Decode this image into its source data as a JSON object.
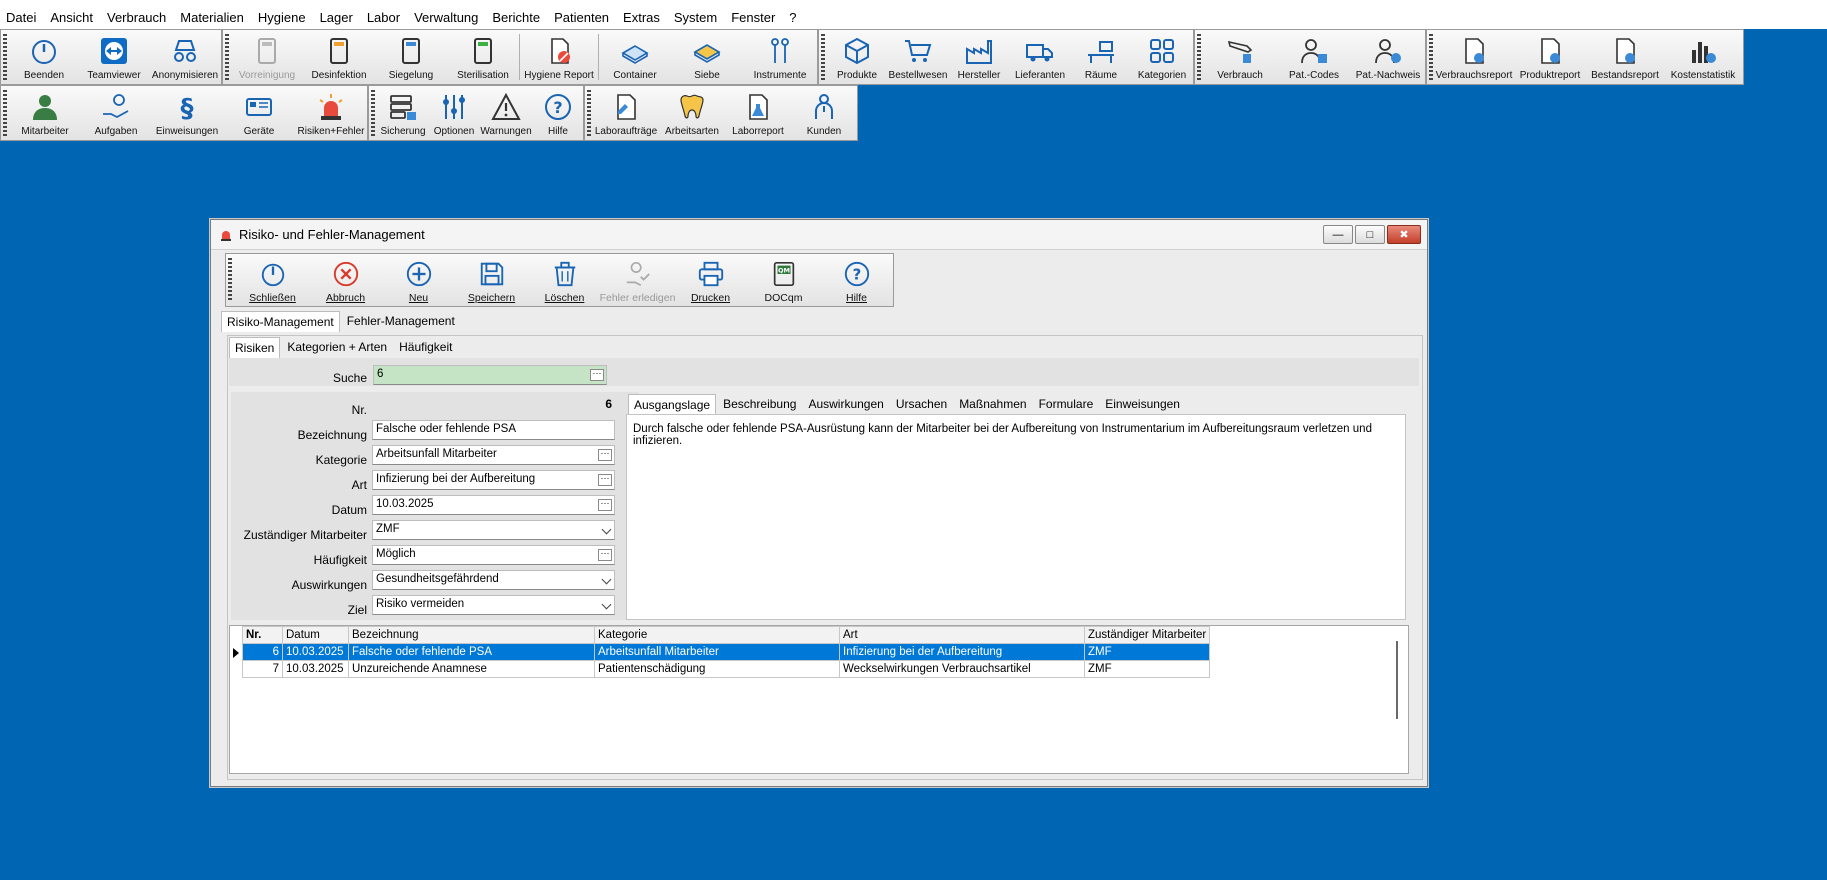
{
  "menu": [
    "Datei",
    "Ansicht",
    "Verbrauch",
    "Materialien",
    "Hygiene",
    "Lager",
    "Labor",
    "Verwaltung",
    "Berichte",
    "Patienten",
    "Extras",
    "System",
    "Fenster",
    "?"
  ],
  "toolbar1": {
    "g1": [
      "Beenden",
      "Teamviewer",
      "Anonymisieren"
    ],
    "g2": [
      "Vorreinigung",
      "Desinfektion",
      "Siegelung",
      "Sterilisation",
      "Hygiene Report"
    ],
    "g3": [
      "Container",
      "Siebe",
      "Instrumente"
    ],
    "g4": [
      "Produkte",
      "Bestellwesen",
      "Hersteller",
      "Lieferanten",
      "Räume",
      "Kategorien"
    ],
    "g5": [
      "Verbrauch",
      "Pat.-Codes",
      "Pat.-Nachweis"
    ],
    "g6": [
      "Verbrauchsreport",
      "Produktreport",
      "Bestandsreport",
      "Kostenstatistik"
    ]
  },
  "toolbar2": {
    "g1": [
      "Mitarbeiter",
      "Aufgaben",
      "Einweisungen",
      "Geräte",
      "Risiken+Fehler"
    ],
    "g2": [
      "Sicherung",
      "Optionen",
      "Warnungen",
      "Hilfe"
    ],
    "g3": [
      "Laboraufträge",
      "Arbeitsarten",
      "Laborreport",
      "Kunden"
    ]
  },
  "window": {
    "title": "Risiko- und Fehler-Management",
    "toolbar": [
      "Schließen",
      "Abbruch",
      "Neu",
      "Speichern",
      "Löschen",
      "Fehler erledigen",
      "Drucken",
      "DOCqm",
      "Hilfe"
    ],
    "tabs_main": [
      "Risiko-Management",
      "Fehler-Management"
    ],
    "tabs_sub": [
      "Risiken",
      "Kategorien + Arten",
      "Häufigkeit"
    ],
    "search_label": "Suche",
    "search_value": "6",
    "form": {
      "nr_label": "Nr.",
      "nr": "6",
      "bez_label": "Bezeichnung",
      "bez": "Falsche oder fehlende PSA",
      "kat_label": "Kategorie",
      "kat": "Arbeitsunfall Mitarbeiter",
      "art_label": "Art",
      "art": "Infizierung bei der Aufbereitung",
      "datum_label": "Datum",
      "datum": "10.03.2025",
      "ma_label": "Zuständiger Mitarbeiter",
      "ma": "ZMF",
      "haeuf_label": "Häufigkeit",
      "haeuf": "Möglich",
      "ausw_label": "Auswirkungen",
      "ausw": "Gesundheitsgefährdend",
      "ziel_label": "Ziel",
      "ziel": "Risiko vermeiden"
    },
    "detail_tabs": [
      "Ausgangslage",
      "Beschreibung",
      "Auswirkungen",
      "Ursachen",
      "Maßnahmen",
      "Formulare",
      "Einweisungen"
    ],
    "detail_text": "Durch falsche oder fehlende PSA-Ausrüstung kann der Mitarbeiter bei der Aufbereitung von Instrumentarium im Aufbereitungsraum verletzen und infizieren.",
    "grid": {
      "headers": [
        "Nr.",
        "Datum",
        "Bezeichnung",
        "Kategorie",
        "Art",
        "Zuständiger Mitarbeiter"
      ],
      "rows": [
        [
          "6",
          "10.03.2025",
          "Falsche oder fehlende PSA",
          "Arbeitsunfall Mitarbeiter",
          "Infizierung bei der Aufbereitung",
          "ZMF"
        ],
        [
          "7",
          "10.03.2025",
          "Unzureichende Anamnese",
          "Patientenschädigung",
          "Weckselwirkungen Verbrauchsartikel",
          "ZMF"
        ]
      ]
    }
  }
}
